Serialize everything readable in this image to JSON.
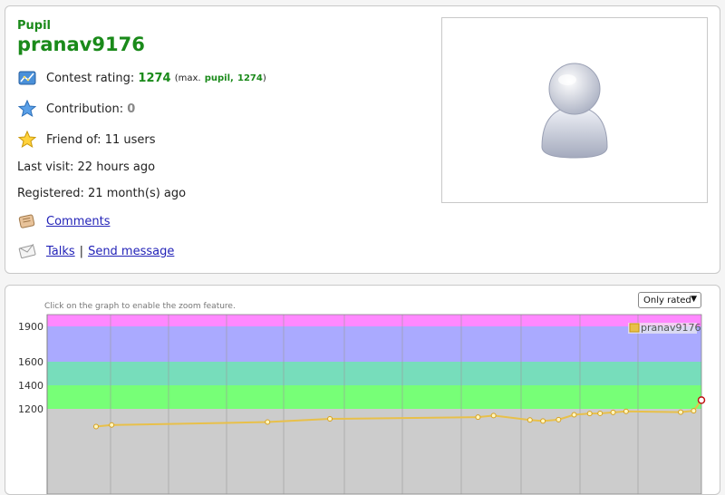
{
  "profile": {
    "rank": "Pupil",
    "handle": "pranav9176",
    "rating_label": "Contest rating:",
    "rating_value": "1274",
    "rating_max_open": "(max.",
    "rating_max_rank": "pupil,",
    "rating_max_value": "1274",
    "rating_max_close": ")",
    "contribution_label": "Contribution:",
    "contribution_value": "0",
    "friend_label": "Friend of:",
    "friend_value": "11 users",
    "last_visit_label": "Last visit:",
    "last_visit_value": "22 hours ago",
    "registered_label": "Registered:",
    "registered_value": "21 month(s) ago",
    "comments_link": "Comments",
    "talks_link": "Talks",
    "separator": "|",
    "send_message_link": "Send message"
  },
  "icons": {
    "rating": "rating-chart-icon",
    "contribution": "blue-star-icon",
    "friend": "gold-star-icon",
    "comments": "comments-icon",
    "talks": "envelope-icon",
    "avatar": "user-silhouette-icon"
  },
  "colors": {
    "rank_green": "#1a8a1a",
    "link_blue": "#2323b8",
    "series_line": "#e8c04a"
  },
  "chart": {
    "zoom_hint": "Click on the graph to enable the zoom feature.",
    "filter_selected": "Only rated"
  },
  "chart_data": {
    "type": "line",
    "series": [
      {
        "name": "pranav9176",
        "values": [
          [
            0.0,
            1050
          ],
          [
            0.6,
            1063
          ],
          [
            6.6,
            1088
          ],
          [
            9.0,
            1115
          ],
          [
            14.7,
            1130
          ],
          [
            15.3,
            1143
          ],
          [
            16.7,
            1106
          ],
          [
            17.2,
            1097
          ],
          [
            17.8,
            1109
          ],
          [
            18.4,
            1150
          ],
          [
            19.0,
            1161
          ],
          [
            19.4,
            1162
          ],
          [
            19.9,
            1170
          ],
          [
            20.4,
            1179
          ],
          [
            22.5,
            1172
          ],
          [
            23.0,
            1184
          ],
          [
            23.3,
            1274
          ]
        ]
      }
    ],
    "yticks": [
      1200,
      1400,
      1600,
      1900
    ],
    "ylim_top": 2000,
    "bands": [
      {
        "from": 1900,
        "to": 2000,
        "color": "#ff88ff"
      },
      {
        "from": 1600,
        "to": 1900,
        "color": "#aaaaff"
      },
      {
        "from": 1400,
        "to": 1600,
        "color": "#77ddbb"
      },
      {
        "from": 1200,
        "to": 1400,
        "color": "#77ff77"
      },
      {
        "from": 0,
        "to": 1200,
        "color": "#cccccc"
      }
    ],
    "legend": "top-right",
    "grid": true
  }
}
